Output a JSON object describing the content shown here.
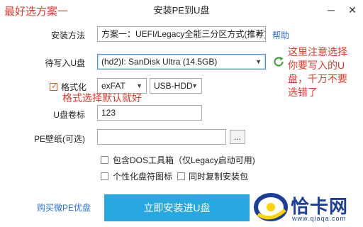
{
  "window": {
    "title": "安装PE到U盘",
    "minimize_glyph": "─",
    "close_glyph": "✕"
  },
  "annotations": {
    "top_left": "最好选方案一",
    "format_note": "格式选择默认就好",
    "right_note_lines": [
      "这里注意选择",
      "你要写入的U",
      "盘，千万不要",
      "选错了"
    ]
  },
  "form": {
    "install_method": {
      "label": "安装方法",
      "value": "方案一：UEFI/Legacy全能三分区方式(推荐)",
      "help_label": "帮助"
    },
    "target_disk": {
      "label": "待写入U盘",
      "value": "(hd2)I: SanDisk Ultra (14.5GB)"
    },
    "format": {
      "label": "格式化",
      "checked": true,
      "fs_value": "exFAT",
      "mode_value": "USB-HDD"
    },
    "volume_label": {
      "label": "U盘卷标",
      "value": "123"
    },
    "wallpaper": {
      "label": "PE壁纸(可选)",
      "value": "",
      "browse_label": "..."
    },
    "options": [
      {
        "label": "包含DOS工具箱（仅Legacy启动可用)",
        "checked": false
      },
      {
        "label": "个性化盘符图标",
        "checked": false
      },
      {
        "label": "同时复制安装包",
        "checked": false
      }
    ]
  },
  "footer": {
    "buy_link": "购买微PE优盘",
    "install_button": "立即安装进U盘"
  },
  "watermark": {
    "brand": "恰卡网",
    "url": "www.qiaqa.com"
  },
  "colors": {
    "annotation_red": "#e03a2c",
    "link_blue": "#2a6fd6",
    "primary_button": "#28a8e0",
    "refresh_green": "#3fa33a"
  }
}
